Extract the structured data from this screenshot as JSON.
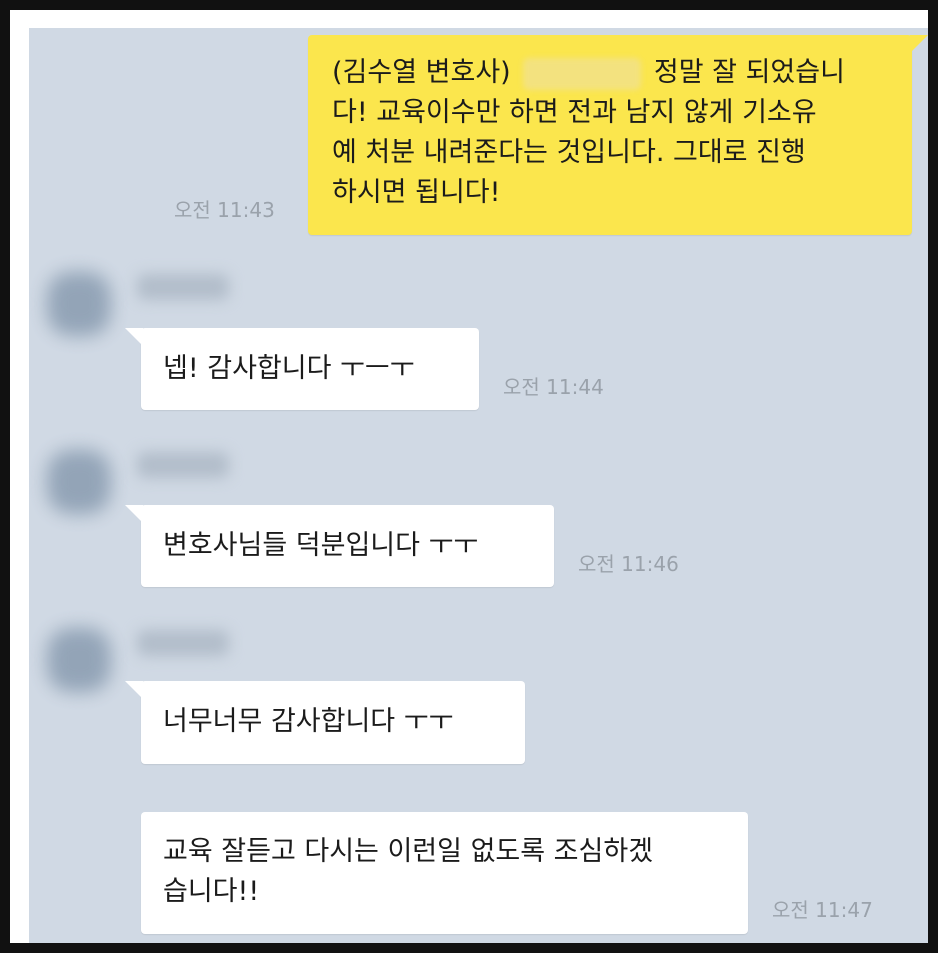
{
  "messages": [
    {
      "sender": "me",
      "lines": [
        "(김수열 변호사)",
        "정말 잘 되었습니",
        "다! 교육이수만 하면 전과 남지 않게 기소유",
        "예 처분 내려준다는 것입니다. 그대로 진행",
        "하시면 됩니다!"
      ],
      "time": "오전 11:43"
    },
    {
      "sender": "other",
      "text": "넵! 감사합니다 ㅜㅡㅜ",
      "time": "오전 11:44"
    },
    {
      "sender": "other",
      "text": "변호사님들 덕분입니다 ㅜㅜ",
      "time": "오전 11:46"
    },
    {
      "sender": "other",
      "text": "너무너무 감사합니다 ㅜㅜ",
      "time": ""
    },
    {
      "sender": "other",
      "lines": [
        "교육 잘듣고 다시는 이런일 없도록 조심하겠",
        "습니다!!"
      ],
      "time": "오전 11:47"
    }
  ],
  "colors": {
    "chat_background": "#d0d9e4",
    "my_bubble": "#fbe64d",
    "other_bubble": "#ffffff",
    "time_text": "#9aa2ab"
  }
}
